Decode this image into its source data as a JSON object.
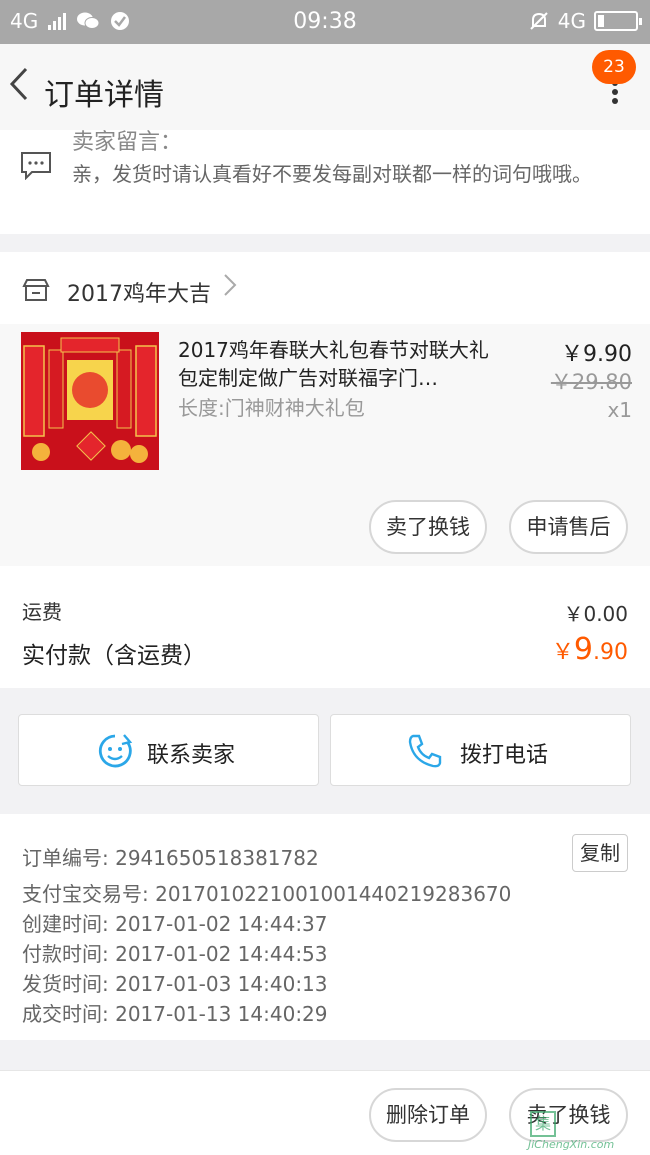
{
  "status_bar": {
    "network_left": "4G",
    "time": "09:38",
    "network_right": "4G"
  },
  "nav": {
    "title": "订单详情",
    "badge": "23"
  },
  "message": {
    "label": "卖家留言：",
    "text": "亲，发货时请认真看好不要发每副对联都一样的词句哦哦。"
  },
  "shop": {
    "name": "2017鸡年大吉"
  },
  "product": {
    "name": "2017鸡年春联大礼包春节对联大礼包定制定做广告对联福字门…",
    "spec": "长度:门神财神大礼包",
    "price": "￥9.90",
    "original_price": "￥29.80",
    "quantity": "x1",
    "sell_button": "卖了换钱",
    "aftersale_button": "申请售后"
  },
  "totals": {
    "freight_label": "运费",
    "freight_value": "￥0.00",
    "paid_label": "实付款（含运费）",
    "paid_currency": "￥",
    "paid_int": "9",
    "paid_dec": ".90"
  },
  "contact": {
    "seller_label": "联系卖家",
    "phone_label": "拨打电话"
  },
  "info": {
    "copy_label": "复制",
    "rows": [
      "订单编号: 2941650518381782",
      "支付宝交易号: 2017010221001001440219283670",
      "创建时间: 2017-01-02 14:44:37",
      "付款时间: 2017-01-02 14:44:53",
      "发货时间: 2017-01-03 14:40:13",
      "成交时间: 2017-01-13 14:40:29"
    ]
  },
  "bottom": {
    "delete_button": "删除订单",
    "sell_button": "卖了换钱"
  },
  "watermark": {
    "url": "JiChengXin.com",
    "mark": "集"
  },
  "colors": {
    "accent": "#ff5a00",
    "status_bar": "#a8a8a8"
  }
}
